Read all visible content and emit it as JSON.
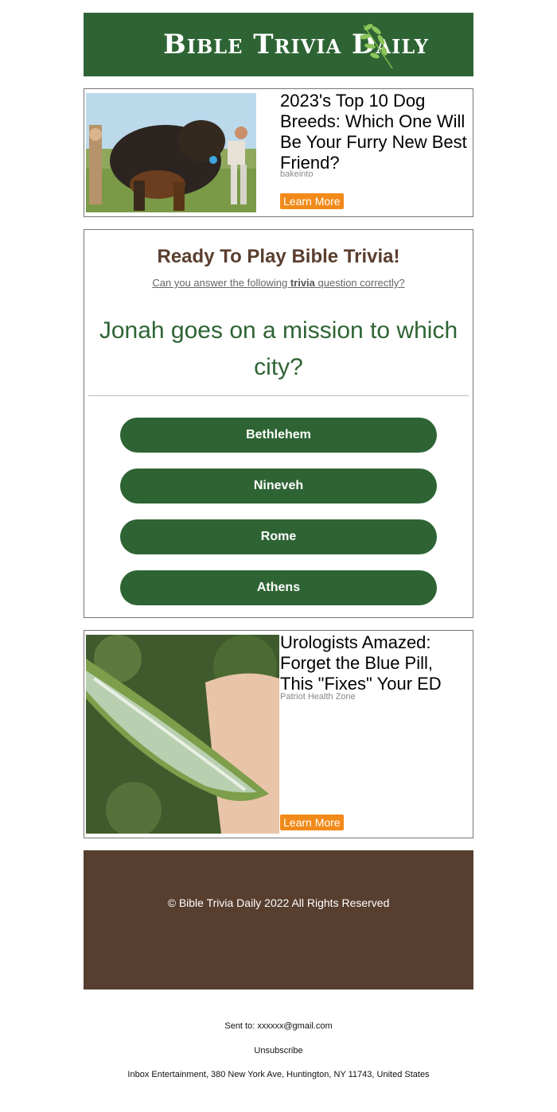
{
  "header": {
    "logo_text": "Bible Trivia Daily",
    "brand_color": "#2e6434"
  },
  "ads": [
    {
      "title": "2023's Top 10 Dog Breeds: Which One Will Be Your Furry New Best Friend?",
      "source": "bakeinto",
      "cta": "Learn More",
      "image": "dog-photo"
    },
    {
      "title": "Urologists Amazed: Forget the Blue Pill, This \"Fixes\" Your ED",
      "source": "Patriot Health Zone",
      "cta": "Learn More",
      "image": "aloe-leaf-photo"
    }
  ],
  "quiz": {
    "heading": "Ready To Play Bible Trivia!",
    "sub_before": "Can you answer the following ",
    "sub_bold": "trivia",
    "sub_after": " question correctly?",
    "question": "Jonah goes on a mission to which city?",
    "answers": [
      "Bethlehem",
      "Nineveh",
      "Rome",
      "Athens"
    ]
  },
  "footer": {
    "copyright": "© Bible Trivia Daily 2022 All Rights Reserved",
    "bg_color": "#573e2f"
  },
  "meta": {
    "sent_to": "Sent to: xxxxxx@gmail.com",
    "unsubscribe": "Unsubscribe",
    "address": "Inbox Entertainment, 380 New York Ave, Huntington, NY 11743, United States"
  },
  "colors": {
    "cta_orange": "#f28a1a",
    "heading_brown": "#5a3e2e"
  }
}
